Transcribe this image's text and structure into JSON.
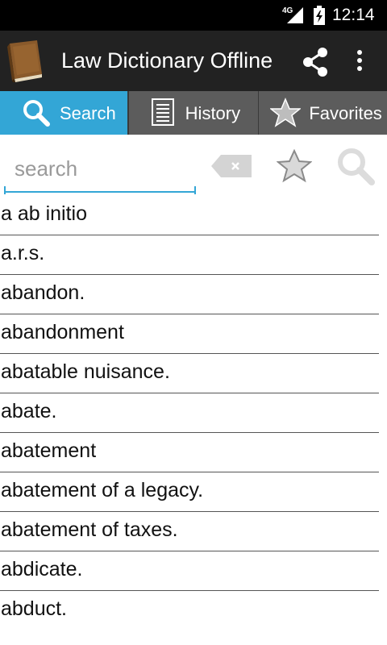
{
  "status_bar": {
    "network": "4G",
    "time": "12:14"
  },
  "action_bar": {
    "title": "Law Dictionary Offline",
    "icons": [
      "book-icon",
      "share-icon",
      "overflow-menu-icon"
    ]
  },
  "tabs": [
    {
      "label": "Search",
      "icon": "magnifier-icon",
      "selected": true
    },
    {
      "label": "History",
      "icon": "list-icon",
      "selected": false
    },
    {
      "label": "Favorites",
      "icon": "star-icon",
      "selected": false
    }
  ],
  "search": {
    "placeholder": "search",
    "value": ""
  },
  "words": [
    "a ab initio",
    "a.r.s.",
    "abandon.",
    "abandonment",
    "abatable nuisance.",
    "abate.",
    "abatement",
    "abatement of a legacy.",
    "abatement of taxes.",
    "abdicate.",
    "abduct."
  ],
  "colors": {
    "accent": "#33a6d6",
    "action_bar": "#222222",
    "tab_inactive": "#5c5c5c",
    "status_bar": "#000000"
  }
}
